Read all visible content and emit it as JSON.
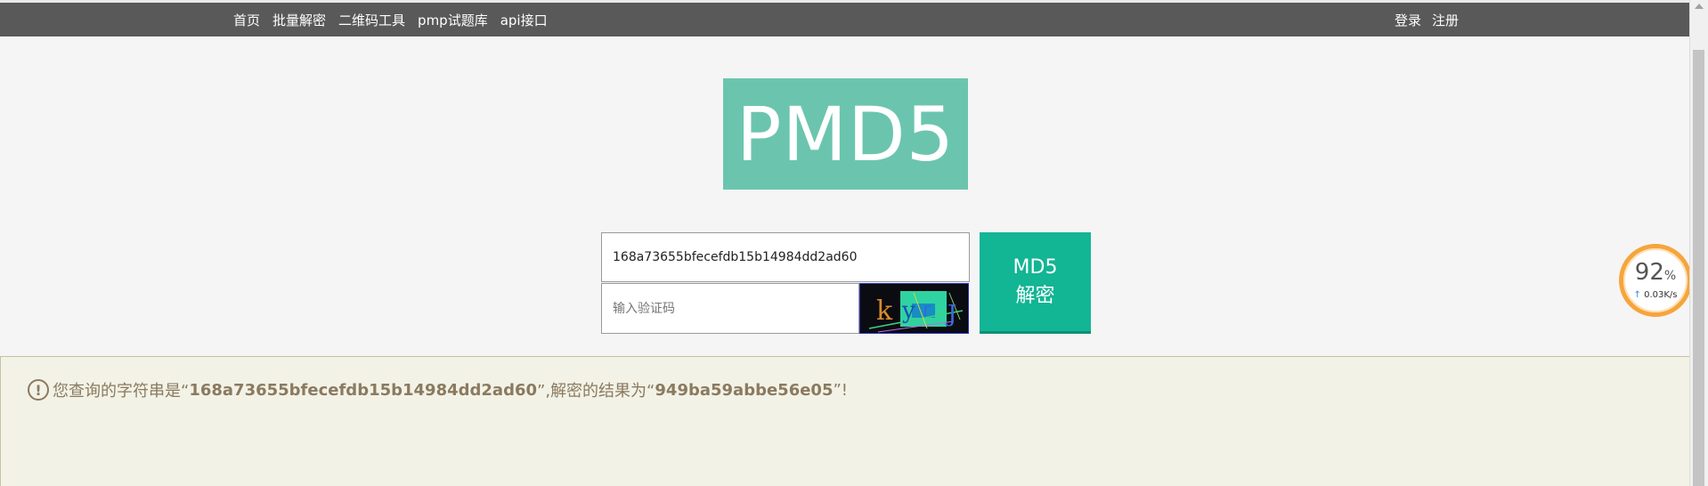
{
  "nav": {
    "left": [
      "首页",
      "批量解密",
      "二维码工具",
      "pmp试题库",
      "api接口"
    ],
    "right": [
      "登录",
      "注册"
    ]
  },
  "logo": {
    "text": "PMD5",
    "color": "#6bc5ae"
  },
  "form": {
    "hash_value": "168a73655bfecefdb15b14984dd2ad60",
    "captcha_placeholder": "输入验证码",
    "captcha_text": "kyrJ",
    "decrypt_label": "MD5\n解密",
    "button_color": "#12b594"
  },
  "result": {
    "prefix": "您查询的字符串是“",
    "query": "168a73655bfecefdb15b14984dd2ad60",
    "middle": "”,解密的结果为“",
    "answer": "949ba59abbe56e05",
    "suffix": "”!"
  },
  "speed_widget": {
    "percent": "92",
    "unit": "%",
    "rate": "0.03K/s"
  }
}
